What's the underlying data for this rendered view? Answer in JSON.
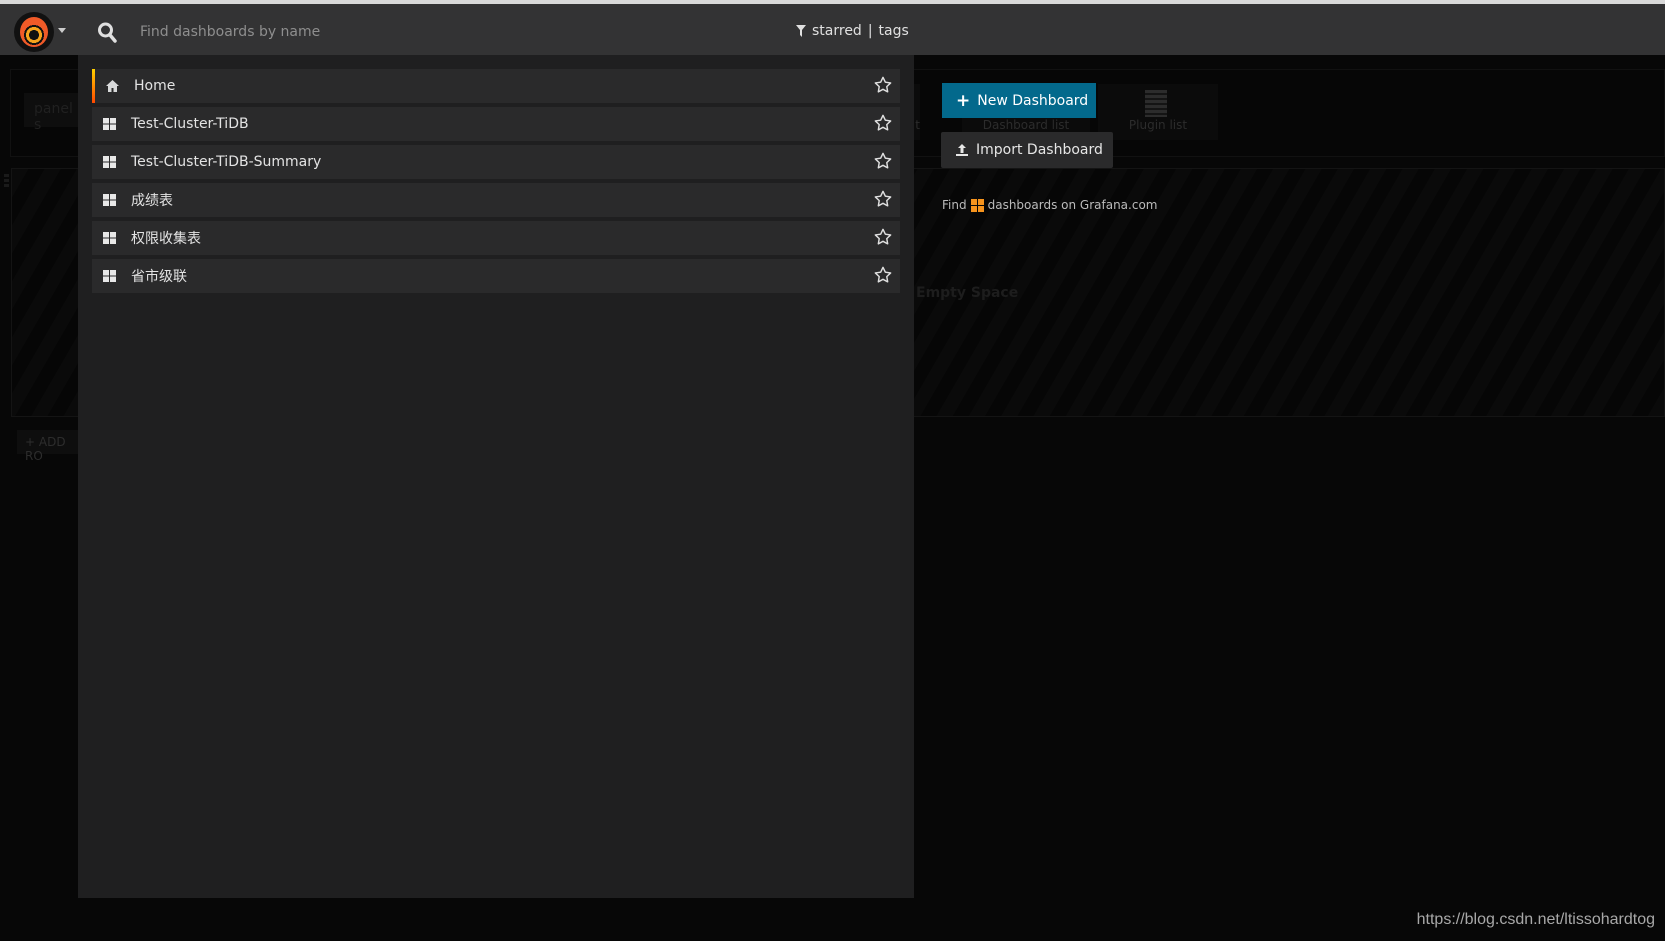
{
  "topbar": {
    "search_placeholder": "Find dashboards by name",
    "filter_starred": "starred",
    "filter_sep": "|",
    "filter_tags": "tags"
  },
  "background": {
    "panel_search": "panel s",
    "card_partial": "t",
    "card_dashboard_list": "Dashboard list",
    "card_plugin_list": "Plugin list",
    "empty_space": "Empty Space",
    "add_row": "+ ADD RO"
  },
  "actions": {
    "new_dashboard": "New Dashboard",
    "import_dashboard": "Import Dashboard",
    "find_prefix": "Find",
    "find_suffix": "dashboards on Grafana.com"
  },
  "dashboards": [
    {
      "label": "Home",
      "icon": "home-icon",
      "active": true
    },
    {
      "label": "Test-Cluster-TiDB",
      "icon": "dashboard-grid-icon"
    },
    {
      "label": "Test-Cluster-TiDB-Summary",
      "icon": "dashboard-grid-icon"
    },
    {
      "label": "成绩表",
      "icon": "dashboard-grid-icon"
    },
    {
      "label": "权限收集表",
      "icon": "dashboard-grid-icon"
    },
    {
      "label": "省市级联",
      "icon": "dashboard-grid-icon"
    }
  ],
  "watermark": "https://blog.csdn.net/ltissohardtog",
  "colors": {
    "accent": "#03698c",
    "active_bar_top": "#ffd500",
    "active_bar_bottom": "#ff4400",
    "grafana_orange": "#f7941d"
  }
}
